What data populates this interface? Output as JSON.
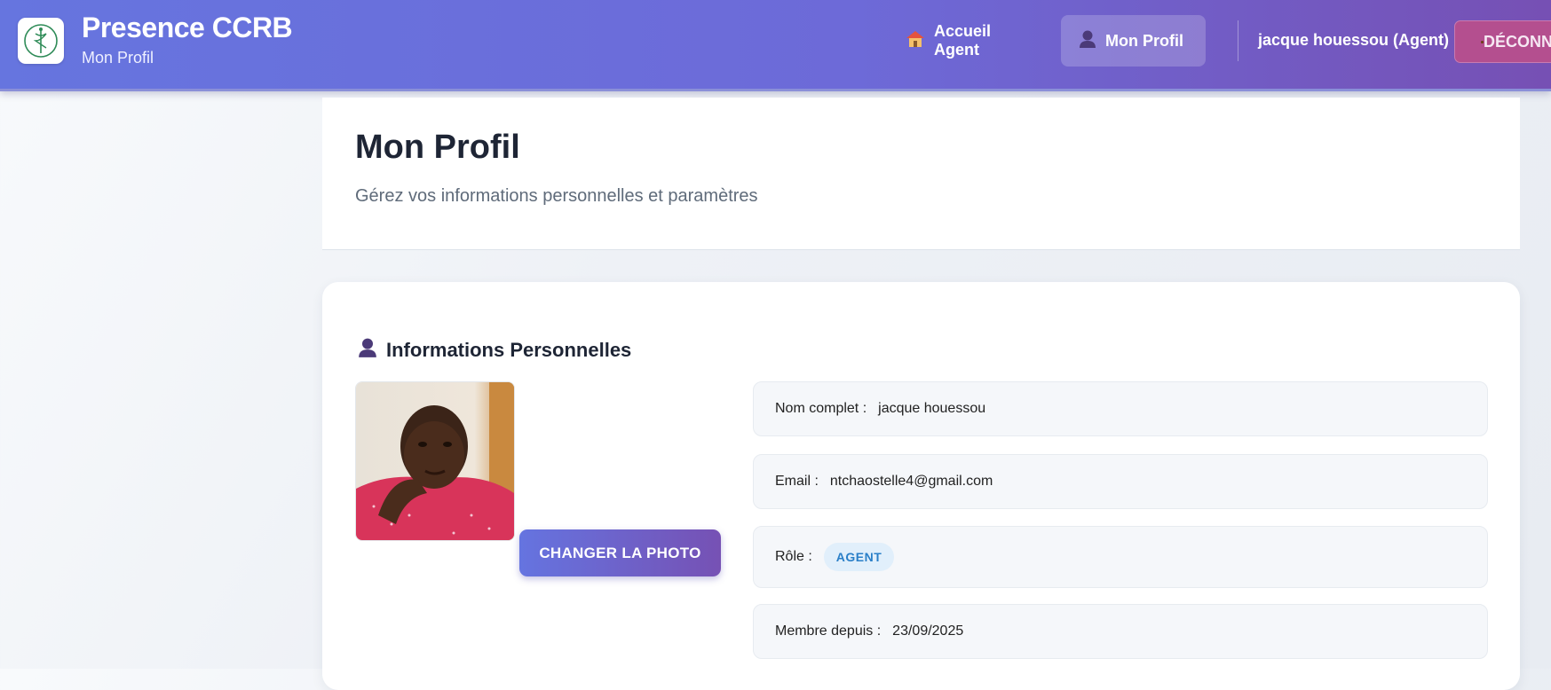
{
  "header": {
    "app_title": "Presence CCRB",
    "app_subtitle": "Mon Profil",
    "logo_icon": "caduceus-logo-icon",
    "nav": {
      "home_label": "Accueil Agent",
      "home_icon": "house-icon",
      "profile_label": "Mon Profil",
      "profile_icon": "user-silhouette-icon"
    },
    "user_label": "jacque houessou (Agent)",
    "logout_label": "DÉCONNEXION",
    "logout_icon": "door-icon"
  },
  "page": {
    "title": "Mon Profil",
    "subtitle": "Gérez vos informations personnelles et paramètres"
  },
  "personal_info": {
    "section_title": "Informations Personnelles",
    "section_icon": "user-silhouette-icon",
    "change_photo_label": "CHANGER LA PHOTO",
    "fields": {
      "name_label": "Nom complet :",
      "name_value": "jacque houessou",
      "email_label": "Email :",
      "email_value": "ntchaostelle4@gmail.com",
      "role_label": "Rôle :",
      "role_value": "AGENT",
      "member_since_label": "Membre depuis :",
      "member_since_value": "23/09/2025"
    }
  },
  "colors": {
    "header_start": "#6675df",
    "header_end": "#7650b4",
    "logout_bg": "#b44f8f",
    "role_badge_bg": "#e1effb",
    "role_badge_text": "#2a7fc8"
  }
}
